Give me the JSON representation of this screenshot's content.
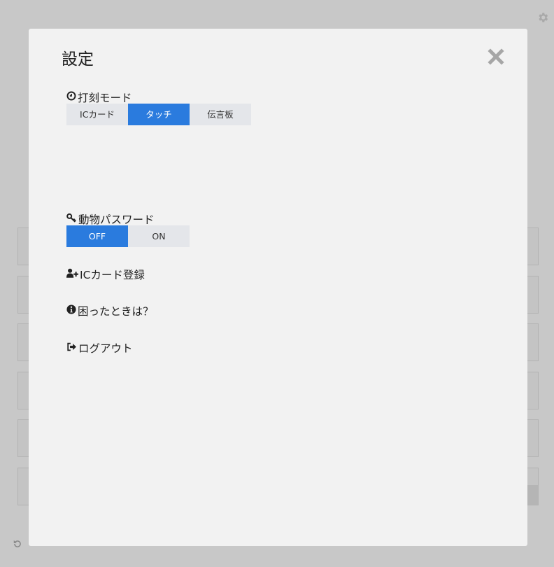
{
  "modal": {
    "title": "設定"
  },
  "punch_mode": {
    "label": "打刻モード",
    "options": [
      "ICカード",
      "タッチ",
      "伝言板"
    ],
    "selected": "タッチ"
  },
  "animal_password": {
    "label": "動物パスワード",
    "options": [
      "OFF",
      "ON"
    ],
    "selected": "OFF"
  },
  "menu": {
    "ic_register": "ICカード登録",
    "help": "困ったときは？",
    "logout": "ログアウト"
  },
  "colors": {
    "accent": "#2a7bde",
    "overlay": "#c8c8c8",
    "modal_bg": "#f2f2f2"
  },
  "icons": {
    "settings": "gear-icon",
    "close": "close-icon",
    "punch_mode": "clock-icon",
    "animal_password": "key-icon",
    "ic_register": "add-user-icon",
    "help": "info-icon",
    "logout": "logout-icon",
    "refresh": "refresh-icon"
  }
}
